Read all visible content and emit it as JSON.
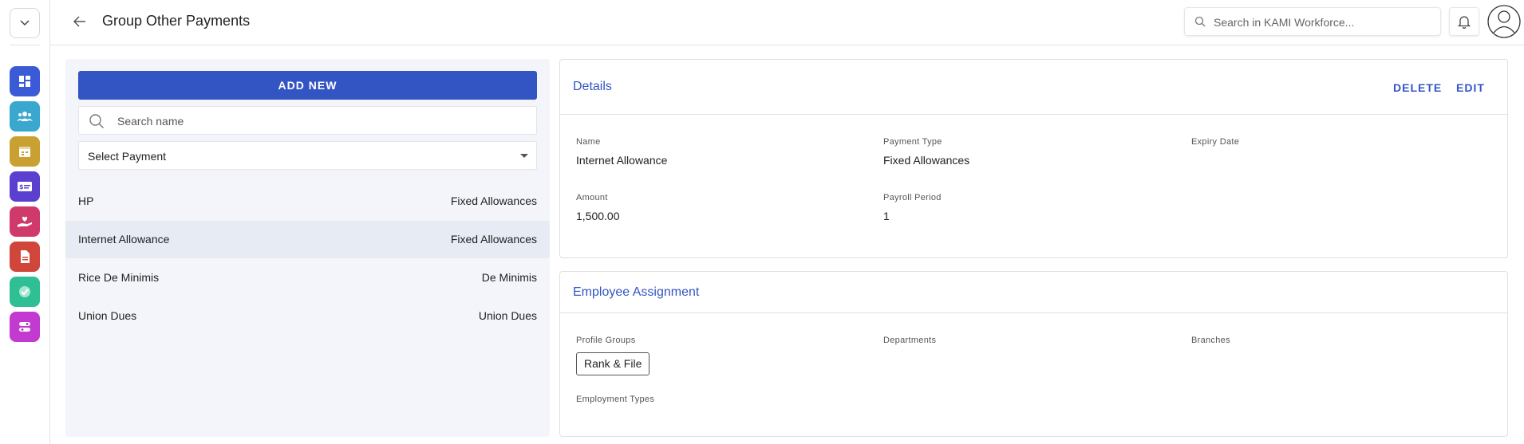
{
  "header": {
    "title": "Group Other Payments",
    "search_placeholder": "Search in KAMI Workforce..."
  },
  "sidebar": {
    "apps": [
      {
        "icon": "dashboard-icon",
        "color": "#3b5bd6"
      },
      {
        "icon": "people-icon",
        "color": "#3aa7cf"
      },
      {
        "icon": "calendar-icon",
        "color": "#c9a132"
      },
      {
        "icon": "payroll-card-icon",
        "color": "#5b3fcf"
      },
      {
        "icon": "benefits-heart-icon",
        "color": "#d03a6a"
      },
      {
        "icon": "document-icon",
        "color": "#d0463a"
      },
      {
        "icon": "checkmark-icon",
        "color": "#2fbf94"
      },
      {
        "icon": "settings-toggle-icon",
        "color": "#c23ad0"
      }
    ]
  },
  "list": {
    "add_label": "ADD NEW",
    "search_placeholder": "Search name",
    "select_label": "Select Payment",
    "items": [
      {
        "name": "HP",
        "type": "Fixed Allowances"
      },
      {
        "name": "Internet Allowance",
        "type": "Fixed Allowances"
      },
      {
        "name": "Rice De Minimis",
        "type": "De Minimis"
      },
      {
        "name": "Union Dues",
        "type": "Union Dues"
      }
    ]
  },
  "details": {
    "title": "Details",
    "delete_label": "DELETE",
    "edit_label": "EDIT",
    "name_label": "Name",
    "name_value": "Internet Allowance",
    "payment_type_label": "Payment Type",
    "payment_type_value": "Fixed Allowances",
    "expiry_label": "Expiry Date",
    "amount_label": "Amount",
    "amount_value": "1,500.00",
    "payroll_period_label": "Payroll Period",
    "payroll_period_value": "1"
  },
  "assignment": {
    "title": "Employee Assignment",
    "profile_groups_label": "Profile Groups",
    "profile_groups": [
      "Rank & File"
    ],
    "departments_label": "Departments",
    "branches_label": "Branches",
    "employment_types_label": "Employment Types"
  },
  "colors": {
    "primary": "#3355c4",
    "selected_row": "#e7ebf4",
    "panel_bg": "#f3f5fa"
  }
}
